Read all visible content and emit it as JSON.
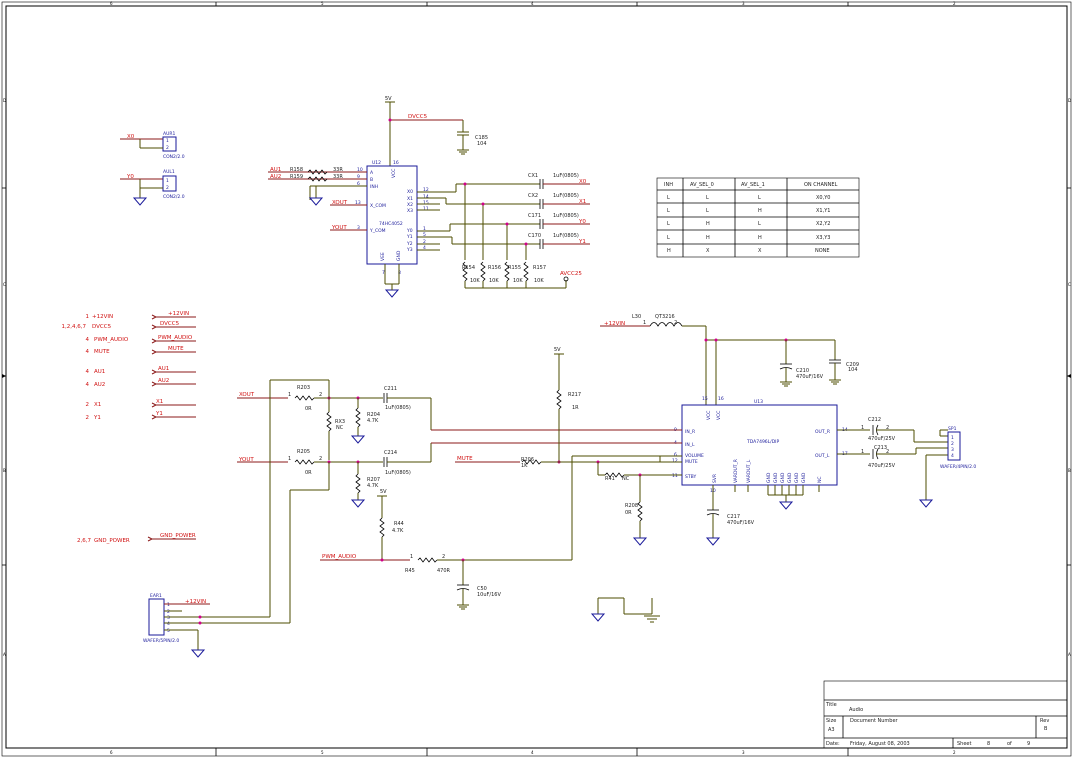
{
  "border": {
    "col_labels": [
      "6",
      "5",
      "4",
      "3",
      "2",
      "1"
    ],
    "row_labels": [
      "D",
      "C",
      "B",
      "A"
    ]
  },
  "nets": {
    "x0": "X0",
    "y0": "Y0",
    "au1": "AU1",
    "au2": "AU2",
    "xout": "XOUT",
    "yout": "YOUT",
    "x0r": "X0",
    "x1r": "X1",
    "y0r": "Y0",
    "y1r": "Y1",
    "dvcc5": "DVCC5",
    "avcc25": "AVCC25",
    "p12vin": "+12VIN",
    "mute": "MUTE",
    "xout2": "XOUT",
    "yout2": "YOUT",
    "pwm": "PWM_AUDIO",
    "p12vin2": "+12VIN",
    "p12vin3": "+12VIN",
    "gnd_power": "GND_POWER"
  },
  "power": {
    "v5a": "5V",
    "v5b": "5V",
    "v5c": "5V"
  },
  "ports": [
    {
      "pins": "1",
      "left": "+12VIN",
      "right": "+12VIN"
    },
    {
      "pins": "1,2,4,6,7",
      "left": "DVCC5",
      "right": "DVCC5"
    },
    {
      "pins": "4",
      "left": "PWM_AUDIO",
      "right": "PWM_AUDIO"
    },
    {
      "pins": "4",
      "left": "MUTE",
      "right": "MUTE"
    },
    {
      "pins": "4",
      "left": "AU1",
      "right": "AU1"
    },
    {
      "pins": "4",
      "left": "AU2",
      "right": "AU2"
    },
    {
      "pins": "2",
      "left": "X1",
      "right": "X1"
    },
    {
      "pins": "2",
      "left": "Y1",
      "right": "Y1"
    }
  ],
  "gnd_port": {
    "pins": "2,6,7",
    "left": "GND_POWER"
  },
  "components": {
    "aur1": "AUR1",
    "aul1": "AUL1",
    "con2a": "CON2/2.0",
    "con2b": "CON2/2.0",
    "u12": "U12",
    "u12_part": "74HC4052",
    "u12_a": "A",
    "u12_b": "B",
    "u12_inh": "INH",
    "u12_xcom": "X_COM",
    "u12_ycom": "Y_COM",
    "u12_x0": "X0",
    "u12_x1": "X1",
    "u12_x2": "X2",
    "u12_x3": "X3",
    "u12_y0": "Y0",
    "u12_y1": "Y1",
    "u12_y2": "Y2",
    "u12_y3": "Y3",
    "u12_vcc": "VCC",
    "u12_vee": "VEE",
    "u12_gnd": "GND",
    "u12_p10": "10",
    "u12_p9": "9",
    "u12_p6": "6",
    "u12_p13": "13",
    "u12_p3": "3",
    "u12_p12": "12",
    "u12_p14": "14",
    "u12_p15": "15",
    "u12_p11": "11",
    "u12_p1": "1",
    "u12_p5": "5",
    "u12_p2": "2",
    "u12_p4": "4",
    "u12_p16": "16",
    "u12_p7": "7",
    "u12_p8": "8",
    "r158": "R158",
    "r159": "R159",
    "r158v": "33R",
    "r159v": "33R",
    "c185": "C185",
    "c185v": "104",
    "cx1": "CX1",
    "cx1v": "1uF(0805)",
    "cx2": "CX2",
    "cx2v": "1uF(0805)",
    "c171": "C171",
    "c171v": "1uF(0805)",
    "c170": "C170",
    "c170v": "1uF(0805)",
    "r154": "R154",
    "r156": "R156",
    "r155": "R155",
    "r157": "R157",
    "r154v": "10K",
    "r156v": "10K",
    "r155v": "10K",
    "r157v": "10K",
    "l30": "L30",
    "l30v": "QT3216",
    "c210": "C210",
    "c210v": "470uF/16V",
    "c209": "C209",
    "c209v": "104",
    "u13": "U13",
    "u13_part": "TDA7496L/DIP",
    "u13_vcc1": "VCC",
    "u13_vcc2": "VCC",
    "u13_inr": "IN_R",
    "u13_inl": "IN_L",
    "u13_volume": "VOLUME",
    "u13_mute": "MUTE",
    "u13_stby": "STBY",
    "u13_outr": "OUT_R",
    "u13_outl": "OUT_L",
    "u13_svr": "SVR",
    "u13_vadjr": "VARDUT_R",
    "u13_vadjl": "VARDUT_L",
    "u13_nc": "NC",
    "u13_g1": "GND",
    "u13_g2": "GND",
    "u13_g3": "GND",
    "u13_g4": "GND",
    "u13_g5": "GND",
    "u13_g6": "GND",
    "u13_p15": "15",
    "u13_p16": "16",
    "u13_p9": "9",
    "u13_p4": "4",
    "u13_p6": "6",
    "u13_p12": "12",
    "u13_p11": "11",
    "u13_p14": "14",
    "u13_p17": "17",
    "u13_p10": "10",
    "r203": "R203",
    "r203v": "0R",
    "r205": "R205",
    "r205v": "0R",
    "r43": "RX3",
    "r43v": "NC",
    "r204": "R204",
    "r204v": "4.7K",
    "r207": "R207",
    "r207v": "4.7K",
    "c211": "C211",
    "c211v": "1uF(0805)",
    "c214": "C214",
    "c214v": "1uF(0805)",
    "r217": "R217",
    "r217v": "1R",
    "r206": "R206",
    "r206v": "1K",
    "r41": "R41",
    "r41v": "NC",
    "r208": "R208",
    "r208v": "0R",
    "c217": "C217",
    "c217v": "470uF/16V",
    "c212": "C212",
    "c212v": "470uF/25V",
    "c213": "C213",
    "c213v": "470uF/25V",
    "sp1": "SP1",
    "sp1_part": "WAFER/4PIN/2.0",
    "r44": "R44",
    "r44v": "4.7K",
    "r45": "R45",
    "r45v": "470R",
    "c50": "C50",
    "c50v": "10uF/16V",
    "ear1": "EAR1",
    "ear1_part": "WAFER/5PIN/2.0"
  },
  "truth_table": {
    "headers": [
      "INH",
      "AV_SEL_0",
      "AV_SEL_1",
      "ON CHANNEL"
    ],
    "rows": [
      [
        "L",
        "L",
        "L",
        "X0,Y0"
      ],
      [
        "L",
        "L",
        "H",
        "X1,Y1"
      ],
      [
        "L",
        "H",
        "L",
        "X2,Y2"
      ],
      [
        "L",
        "H",
        "H",
        "X3,Y3"
      ],
      [
        "H",
        "X",
        "X",
        "NONE"
      ]
    ]
  },
  "title_block": {
    "title_label": "Title",
    "title": "Audio",
    "size_label": "Size",
    "size": "A3",
    "docnum_label": "Document Number",
    "rev_label": "Rev",
    "rev": "B",
    "date_label": "Date:",
    "date": "Friday, August 08, 2003",
    "sheet_label": "Sheet",
    "sheet": "8",
    "of_label": "of",
    "total": "9"
  }
}
